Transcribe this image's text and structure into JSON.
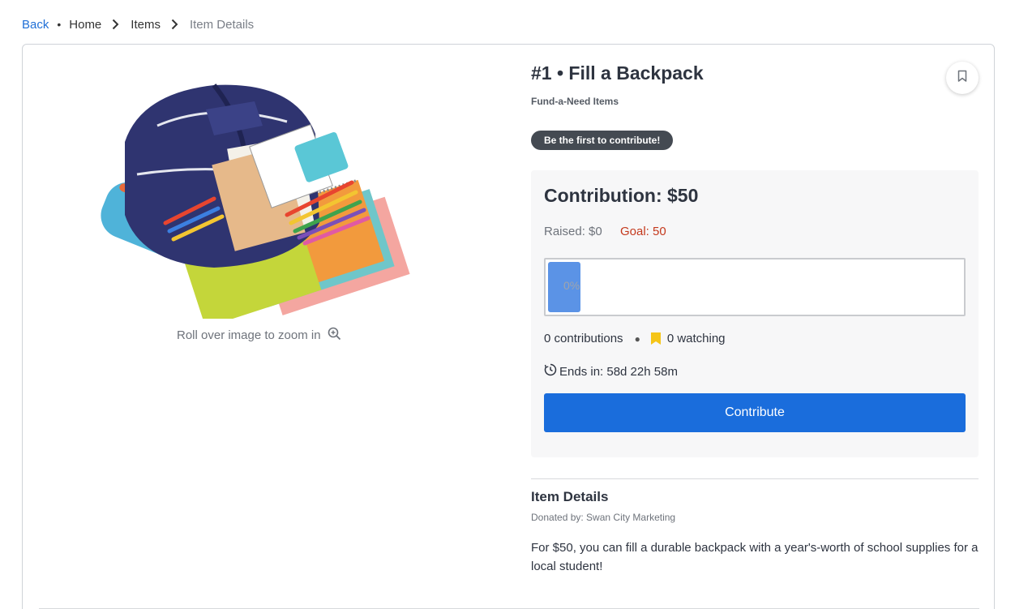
{
  "breadcrumb": {
    "back": "Back",
    "home": "Home",
    "items": "Items",
    "current": "Item Details"
  },
  "item": {
    "title": "#1 • Fill a Backpack",
    "category": "Fund-a-Need Items",
    "badge": "Be the first to contribute!",
    "zoom_hint": "Roll over image to zoom in",
    "image_icon": "backpack-with-school-supplies"
  },
  "contribution": {
    "title": "Contribution: $50",
    "raised": "Raised: $0",
    "goal": "Goal: 50",
    "progress_label": "0%",
    "progress_fraction": 0,
    "contributions": "0 contributions",
    "watching": "0 watching",
    "ends": "Ends in: 58d 22h 58m",
    "button": "Contribute"
  },
  "details": {
    "heading": "Item Details",
    "donor": "Donated by: Swan City Marketing",
    "description": "For $50, you can fill a durable backpack with a year's-worth of school supplies for a local student!"
  },
  "colors": {
    "accent": "#1a6ddc",
    "link": "#1f6fd6",
    "goal": "#c4391d",
    "progress": "#5b93e6",
    "watch_icon": "#f5c518",
    "badge": "#444a52"
  }
}
